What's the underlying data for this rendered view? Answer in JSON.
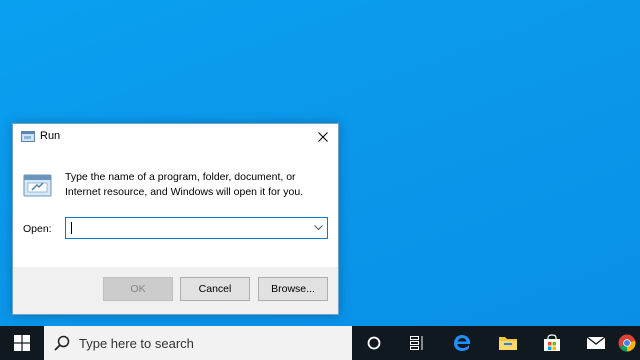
{
  "dialog": {
    "title": "Run",
    "close_glyph": "✕",
    "description": "Type the name of a program, folder, document, or Internet resource, and Windows will open it for you.",
    "open_label": "Open:",
    "open_value": "",
    "ok_label": "OK",
    "cancel_label": "Cancel",
    "browse_label": "Browse..."
  },
  "taskbar": {
    "search_placeholder": "Type here to search",
    "icons": [
      "windows-start-icon",
      "search-icon",
      "cortana-icon",
      "task-view-icon",
      "edge-icon",
      "file-explorer-icon",
      "store-icon",
      "mail-icon",
      "chrome-icon"
    ]
  },
  "colors": {
    "desktop_accent": "#0a9ae8",
    "focus_border": "#0078d7",
    "taskbar_bg": "#101820"
  }
}
